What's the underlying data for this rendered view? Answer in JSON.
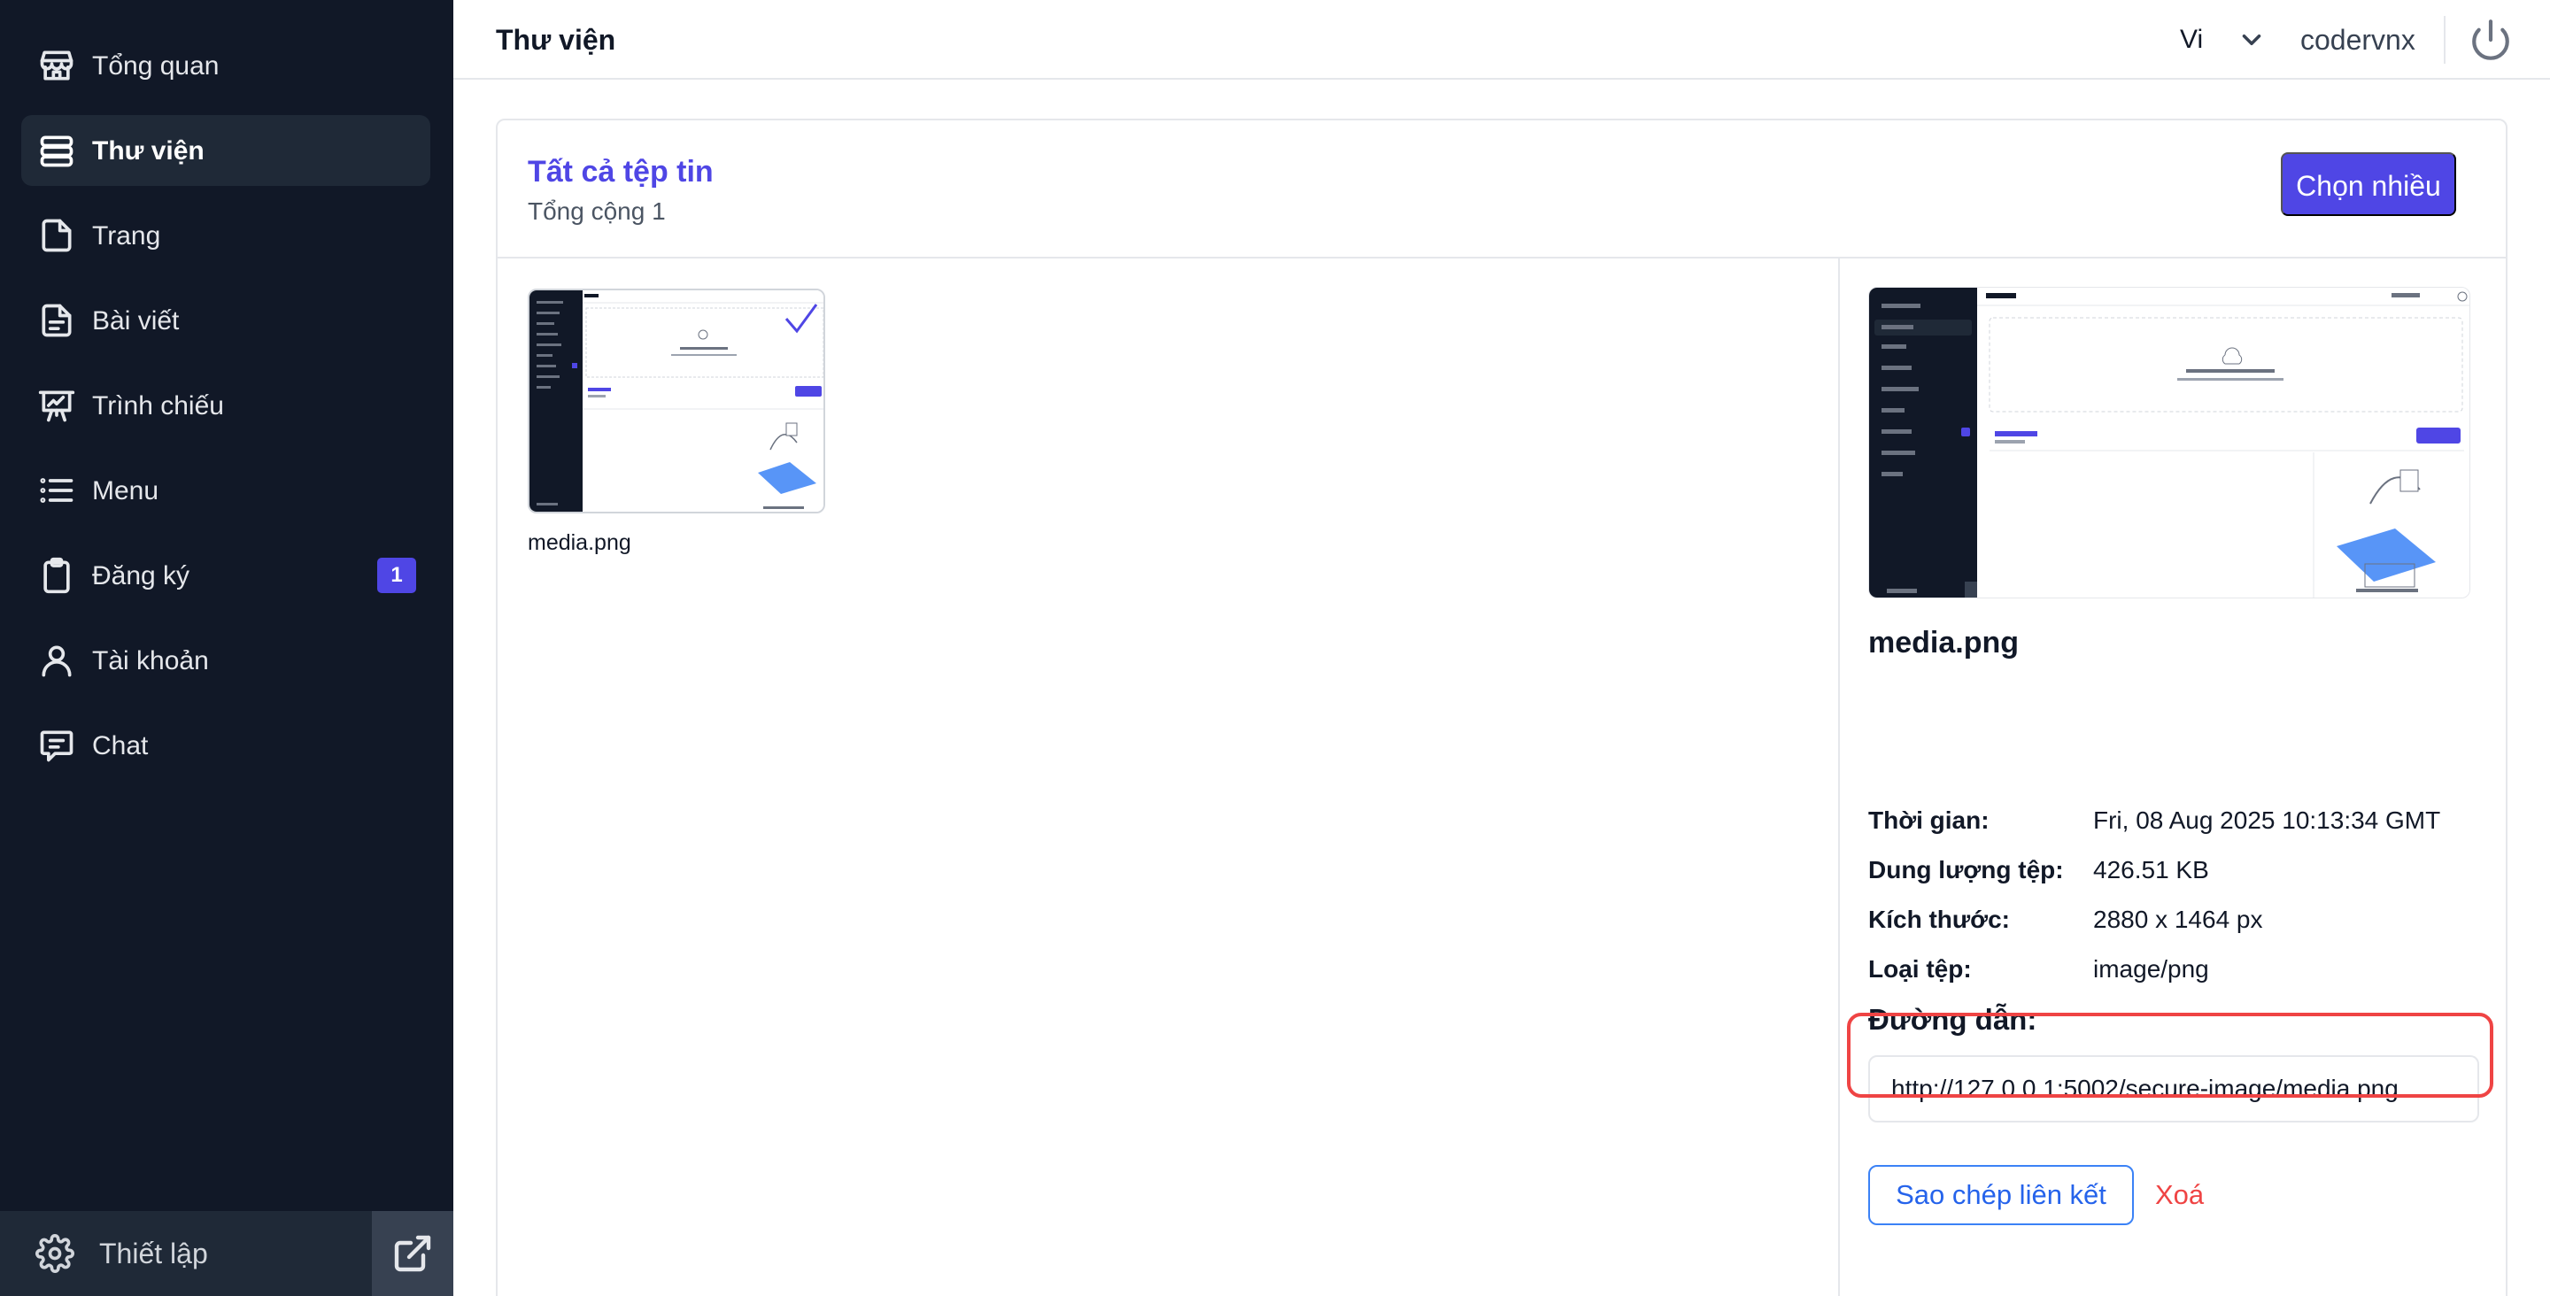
{
  "sidebar": {
    "items": [
      {
        "label": "Tổng quan",
        "icon": "store-icon"
      },
      {
        "label": "Thư viện",
        "icon": "database-icon",
        "active": true
      },
      {
        "label": "Trang",
        "icon": "file-icon"
      },
      {
        "label": "Bài viết",
        "icon": "file-text-icon"
      },
      {
        "label": "Trình chiếu",
        "icon": "presentation-icon"
      },
      {
        "label": "Menu",
        "icon": "list-icon"
      },
      {
        "label": "Đăng ký",
        "icon": "clipboard-icon",
        "badge": "1"
      },
      {
        "label": "Tài khoản",
        "icon": "user-icon"
      },
      {
        "label": "Chat",
        "icon": "message-icon"
      }
    ],
    "settings_label": "Thiết lập"
  },
  "header": {
    "title": "Thư viện",
    "language": "Vi",
    "username": "codervnx"
  },
  "library": {
    "title": "Tất cả tệp tin",
    "total": "Tổng cộng 1",
    "select_multiple": "Chọn nhiều",
    "files": [
      {
        "name": "media.png",
        "selected": true
      }
    ]
  },
  "detail": {
    "filename": "media.png",
    "meta": [
      {
        "key": "Thời gian:",
        "value": "Fri, 08 Aug 2025 10:13:34 GMT"
      },
      {
        "key": "Dung lượng tệp:",
        "value": "426.51 KB"
      },
      {
        "key": "Kích thước:",
        "value": "2880 x 1464 px"
      },
      {
        "key": "Loại tệp:",
        "value": "image/png"
      }
    ],
    "path_label": "Đường dẫn:",
    "path_value": "http://127.0.0.1:5002/secure-image/media.png",
    "copy_label": "Sao chép liên kết",
    "delete_label": "Xoá"
  },
  "colors": {
    "sidebar_bg": "#111827",
    "accent": "#4f46e5",
    "danger": "#ef4444",
    "link": "#2563eb"
  }
}
